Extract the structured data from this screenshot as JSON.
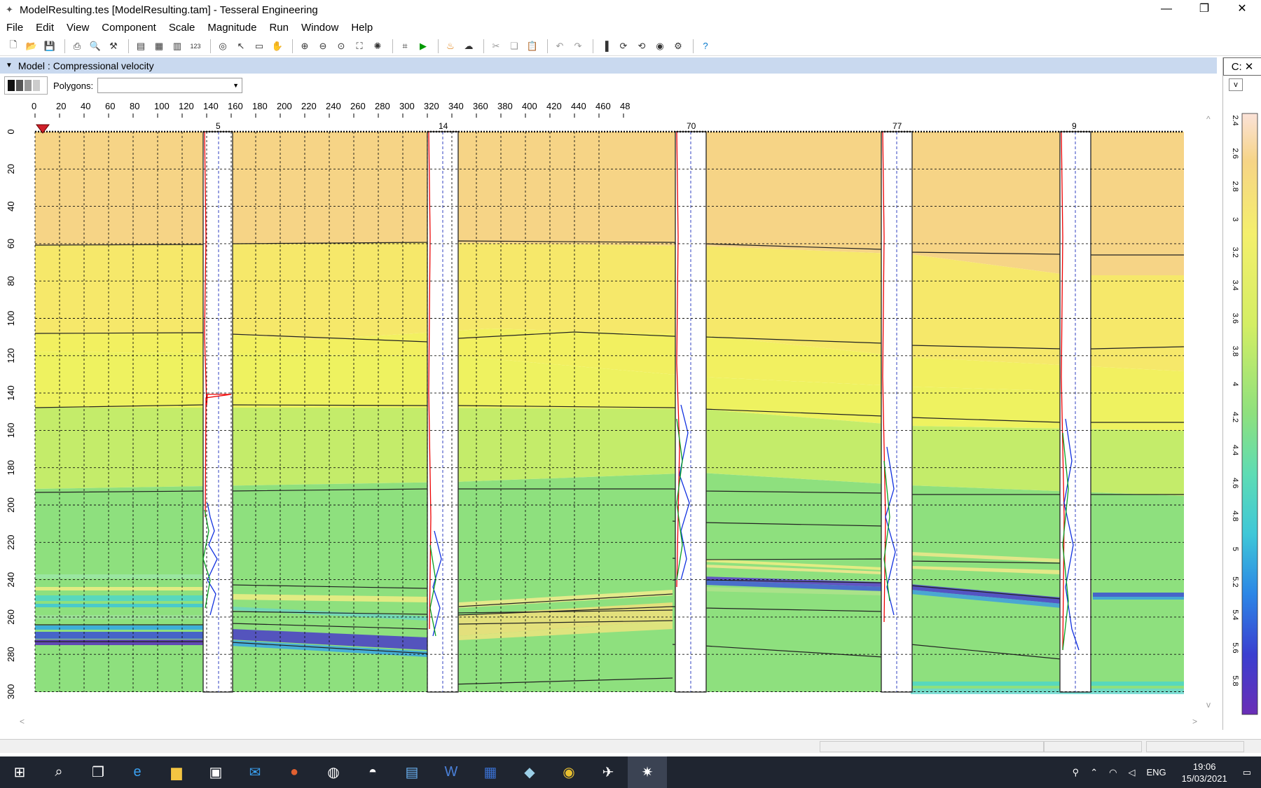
{
  "window": {
    "title": "ModelResulting.tes [ModelResulting.tam] - Tesseral Engineering",
    "min": "—",
    "max": "❐",
    "close": "✕"
  },
  "menu": [
    "File",
    "Edit",
    "View",
    "Component",
    "Scale",
    "Magnitude",
    "Run",
    "Window",
    "Help"
  ],
  "toolbar_icons": [
    "new-icon",
    "open-icon",
    "save-icon",
    "print-icon",
    "print-preview-icon",
    "hammer-icon",
    "layers-icon",
    "grid-icon",
    "table-icon",
    "numbers-icon",
    "target-icon",
    "pointer-icon",
    "rectangle-select-icon",
    "hand-icon",
    "zoom-in-icon",
    "zoom-out-icon",
    "zoom-fit-icon",
    "extent-icon",
    "wand-icon",
    "model-icon",
    "run-icon",
    "fire-icon",
    "render-icon",
    "cut-icon",
    "copy-icon",
    "paste-icon",
    "undo-icon",
    "redo-icon",
    "palette-icon",
    "rotate-icon",
    "rotate-2-icon",
    "globe-icon",
    "settings-icon",
    "help-icon"
  ],
  "panel": {
    "title": "Model : Compressional velocity"
  },
  "polygons": {
    "label": "Polygons:",
    "value": ""
  },
  "right_panel": {
    "btn1": "C:",
    "btn2": "✕",
    "v_label": "v"
  },
  "plot": {
    "x_ticks": [
      "0",
      "20",
      "40",
      "60",
      "80",
      "100",
      "120",
      "140",
      "160",
      "180",
      "200",
      "220",
      "240",
      "260",
      "280",
      "300",
      "320",
      "340",
      "360",
      "380",
      "400",
      "420",
      "440",
      "460",
      "48"
    ],
    "y_ticks": [
      "0",
      "20",
      "40",
      "60",
      "80",
      "100",
      "120",
      "140",
      "160",
      "180",
      "200",
      "220",
      "240",
      "260",
      "280",
      "300"
    ],
    "wells": [
      "5",
      "14",
      "70",
      "77",
      "9"
    ],
    "colorbar_ticks": [
      "2.4",
      "2.6",
      "2.8",
      "3",
      "3.2",
      "3.4",
      "3.6",
      "3.8",
      "4",
      "4.2",
      "4.4",
      "4.6",
      "4.8",
      "5",
      "5.2",
      "5.4",
      "5.6",
      "5.8"
    ]
  },
  "taskbar": {
    "icons": [
      "windows-start-icon",
      "search-icon",
      "task-view-icon",
      "edge-icon",
      "file-explorer-icon",
      "store-icon",
      "mail-icon",
      "drop-icon",
      "app-icon",
      "photos-icon",
      "doc-icon",
      "word-icon",
      "calculator-icon",
      "app2-icon",
      "chrome-icon",
      "plane-icon",
      "tesseral-icon"
    ],
    "lang": "ENG",
    "time": "19:06",
    "date": "15/03/2021"
  }
}
